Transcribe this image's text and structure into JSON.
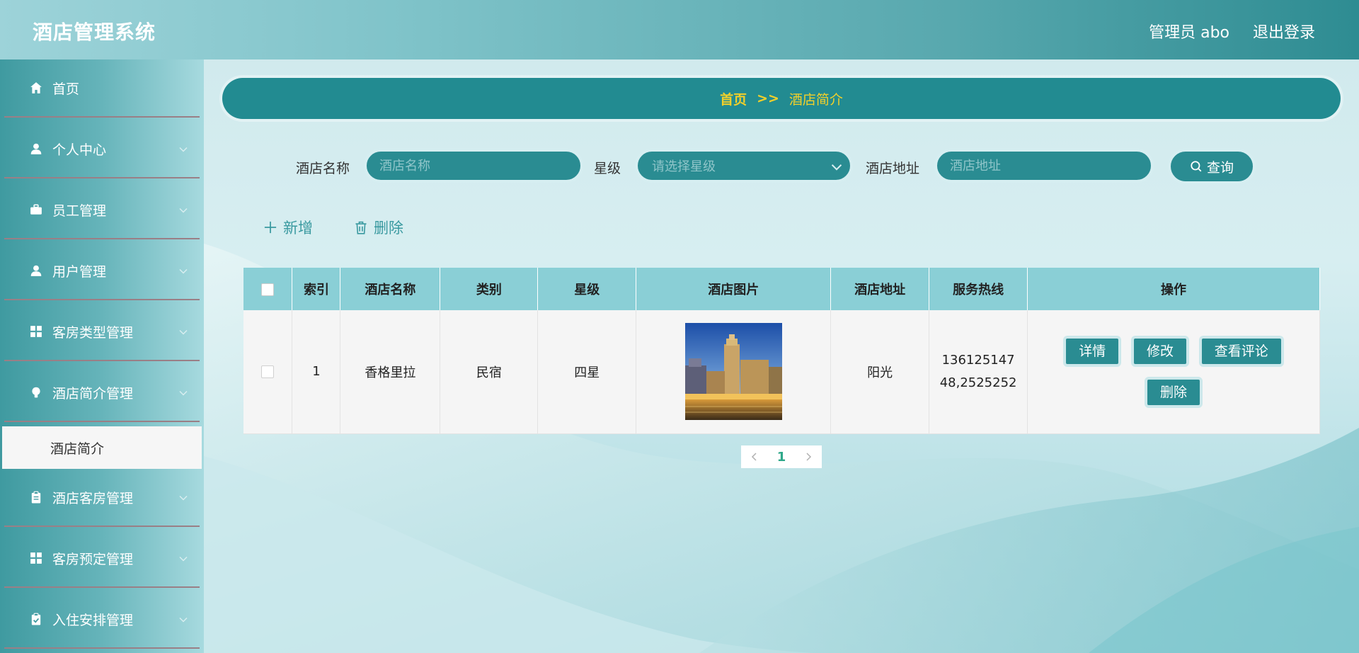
{
  "app": {
    "title": "酒店管理系统",
    "user": "管理员 abo",
    "logout": "退出登录"
  },
  "sidebar": {
    "items": [
      {
        "label": "首页",
        "icon": "home-icon"
      },
      {
        "label": "个人中心",
        "icon": "person-icon"
      },
      {
        "label": "员工管理",
        "icon": "briefcase-icon"
      },
      {
        "label": "用户管理",
        "icon": "person-icon"
      },
      {
        "label": "客房类型管理",
        "icon": "grid-icon"
      },
      {
        "label": "酒店简介管理",
        "icon": "bulb-icon"
      },
      {
        "label": "酒店客房管理",
        "icon": "clipboard-icon"
      },
      {
        "label": "客房预定管理",
        "icon": "grid-icon"
      },
      {
        "label": "入住安排管理",
        "icon": "clipboard-check-icon"
      }
    ],
    "active_sub": "酒店简介"
  },
  "breadcrumb": {
    "home": "首页",
    "separator": ">>",
    "current": "酒店简介"
  },
  "search": {
    "name_label": "酒店名称",
    "name_placeholder": "酒店名称",
    "star_label": "星级",
    "star_placeholder": "请选择星级",
    "address_label": "酒店地址",
    "address_placeholder": "酒店地址",
    "query": "查询"
  },
  "actions": {
    "add": "新增",
    "delete": "删除"
  },
  "table": {
    "headers": [
      "索引",
      "酒店名称",
      "类别",
      "星级",
      "酒店图片",
      "酒店地址",
      "服务热线",
      "操作"
    ],
    "rows": [
      {
        "index": "1",
        "name": "香格里拉",
        "category": "民宿",
        "star": "四星",
        "image": "hotel-photo",
        "address": "阳光",
        "hotline_line1": "136125147",
        "hotline_line2": "48,2525252",
        "ops": {
          "detail": "详情",
          "edit": "修改",
          "comments": "查看评论",
          "delete": "删除"
        }
      }
    ]
  },
  "pagination": {
    "current": "1"
  },
  "colors": {
    "primary": "#228b91",
    "breadcrumb_text": "#f2d02a",
    "table_header": "#8acfd6"
  }
}
